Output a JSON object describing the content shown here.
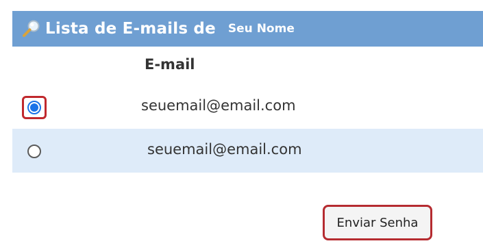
{
  "header": {
    "icon": "magnifier-icon",
    "title": "Lista de E-mails de",
    "user_name": "Seu Nome",
    "background_color": "#6f9fd2"
  },
  "table": {
    "column_header": "E-mail",
    "rows": [
      {
        "email": "seuemail@email.com",
        "selected": true
      },
      {
        "email": "seuemail@email.com",
        "selected": false
      }
    ],
    "alt_row_color": "#deebf9"
  },
  "actions": {
    "send_label": "Enviar Senha",
    "highlight_color": "#c0282d"
  }
}
